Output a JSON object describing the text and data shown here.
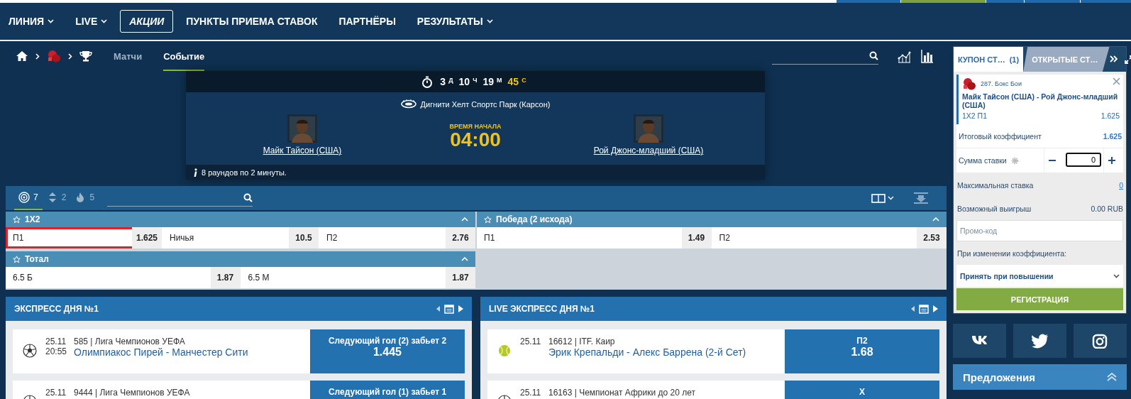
{
  "nav": [
    {
      "label": "ЛИНИЯ",
      "kind": "dropdown"
    },
    {
      "label": "LIVE",
      "kind": "dropdown"
    },
    {
      "label": "АКЦИИ",
      "kind": "boxed"
    },
    {
      "label": "ПУНКТЫ ПРИЕМА СТАВОК",
      "kind": "plain"
    },
    {
      "label": "ПАРТНЁРЫ",
      "kind": "plain"
    },
    {
      "label": "РЕЗУЛЬТАТЫ",
      "kind": "dropdown"
    }
  ],
  "breadcrumb": {
    "tabs": [
      {
        "label": "Матчи",
        "selected": false
      },
      {
        "label": "Событие",
        "selected": true
      }
    ]
  },
  "event": {
    "countdown": [
      {
        "value": "3",
        "unit": "Д",
        "highlight": false
      },
      {
        "value": "10",
        "unit": "Ч",
        "highlight": false
      },
      {
        "value": "19",
        "unit": "М",
        "highlight": false
      },
      {
        "value": "45",
        "unit": "С",
        "highlight": true
      }
    ],
    "venue": "Дигнити Хелт Спортс Парк (Карсон)",
    "team1": "Майк Тайсон (США)",
    "team2": "Рой Джонс-младший (США)",
    "start_label": "ВРЕМЯ НАЧАЛА",
    "start_time": "04:00",
    "info": "8 раундов по 2 минуты."
  },
  "filters": [
    {
      "kind": "target",
      "count": "7",
      "selected": true
    },
    {
      "kind": "updown",
      "count": "2",
      "selected": false
    },
    {
      "kind": "fire",
      "count": "5",
      "selected": false
    }
  ],
  "markets": [
    {
      "title": "1X2",
      "outcomes": [
        {
          "label": "П1",
          "odds": "1.625",
          "selected": true
        },
        {
          "label": "Ничья",
          "odds": "10.5",
          "selected": false
        },
        {
          "label": "П2",
          "odds": "2.76",
          "selected": false
        }
      ]
    },
    {
      "title": "Победа (2 исхода)",
      "outcomes": [
        {
          "label": "П1",
          "odds": "1.49",
          "selected": false
        },
        {
          "label": "П2",
          "odds": "2.53",
          "selected": false
        }
      ]
    },
    {
      "title": "Тотал",
      "outcomes": [
        {
          "label": "6.5 Б",
          "odds": "1.87",
          "selected": false
        },
        {
          "label": "6.5 М",
          "odds": "1.87",
          "selected": false
        }
      ]
    }
  ],
  "express": [
    {
      "title": "ЭКСПРЕСС ДНЯ №1",
      "rows": [
        {
          "kind": "soccer",
          "date": "25.11",
          "time": "20:55",
          "league": "585 | Лига Чемпионов УЕФА",
          "match": "Олимпиакос Пирей - Манчестер Сити",
          "pick": "Следующий гол (2) забьет 2",
          "odds": "1.445"
        },
        {
          "kind": "soccer",
          "date": "25.11",
          "league": "9444 | Лига Чемпионов УЕФА",
          "pick": "Следующий гол (1) забьет 1"
        }
      ]
    },
    {
      "title": "LIVE ЭКСПРЕСС ДНЯ №1",
      "rows": [
        {
          "kind": "tennis",
          "date": "25.11",
          "league": "16612 | ITF. Каир",
          "match": "Эрик Крепальди - Алекс Баррена (2-й Сет)",
          "pick": "П2",
          "odds": "1.68"
        },
        {
          "kind": "soccer",
          "date": "25.11",
          "league": "16163 | Чемпионат Африки до 20 лет",
          "pick": "Х"
        }
      ]
    }
  ],
  "top_bar": [
    {
      "color": "#1f6aae"
    },
    {
      "color": "#7ea23c"
    },
    {
      "color": "#1f6aae"
    },
    {
      "color": "#1f6aae"
    },
    {
      "color": "#1f6aae"
    }
  ],
  "coupon": {
    "tabs": [
      {
        "label": "КУПОН СТ…",
        "count": "(1)",
        "selected": true
      },
      {
        "label": "ОТКРЫТЫЕ СТ…",
        "selected": false
      }
    ],
    "bet": {
      "sport": "287. Бокс Бои",
      "match": "Майк Тайсон (США) - Рой Джонс-младший (США)",
      "market": "1X2 П1",
      "odds": "1.625"
    },
    "total_label": "Итоговый коэффициент",
    "total_value": "1.625",
    "stake_label": "Сумма ставки",
    "stake_value": "0",
    "max_label": "Максимальная ставка",
    "max_value": "0",
    "win_label": "Возможный выигрыш",
    "win_value": "0.00 RUB",
    "promo": {
      "placeholder": "Промо-код"
    },
    "change_label": "При изменении коэффициента:",
    "change_value": "Принять при повышении",
    "button": "РЕГИСТРАЦИЯ"
  },
  "socials": [
    {
      "kind": "vk"
    },
    {
      "kind": "twitter"
    },
    {
      "kind": "instagram"
    }
  ],
  "offers": {
    "title": "Предложения",
    "expanded": true
  }
}
